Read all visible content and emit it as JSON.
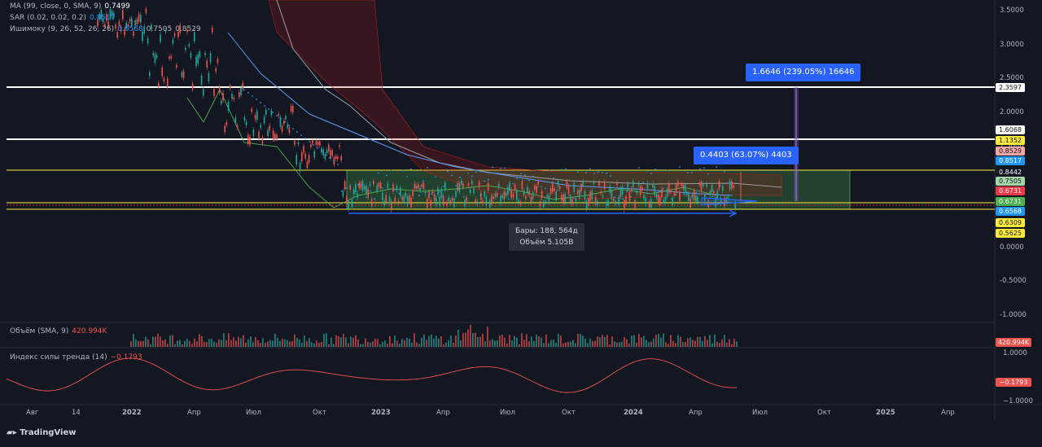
{
  "legend": {
    "ma": {
      "label": "MA (99, close, 0, SMA, 9)",
      "value": "0.7499",
      "value_color": "#ffffff"
    },
    "sar": {
      "label": "SAR (0.02, 0.02, 0.2)",
      "value": "0.8517",
      "value_color": "#2196f3"
    },
    "ichimoku": {
      "label": "Ишимоку (9, 26, 52, 26, 26)",
      "values": [
        "0.6568",
        "0.7505",
        "0.8529"
      ],
      "value_colors": [
        "#2196f3",
        "#ffffff",
        "#ffffff"
      ]
    }
  },
  "price_axis": [
    "3.5000",
    "3.0000",
    "2.5000",
    "2.0000",
    "1.5000",
    "1.0000",
    "0.5000",
    "0.0000",
    "-0.5000",
    "-1.0000"
  ],
  "price_tags": [
    {
      "text": "2.3597",
      "bg": "#ffffff",
      "fg": "#131722"
    },
    {
      "text": "1.6068",
      "bg": "#ffffff",
      "fg": "#131722"
    },
    {
      "text": "1.1352",
      "bg": "#ffeb3b",
      "fg": "#131722"
    },
    {
      "text": "0.8529",
      "bg": "#f8a5a5",
      "fg": "#131722"
    },
    {
      "text": "0.8517",
      "bg": "#2196f3",
      "fg": "#ffffff"
    },
    {
      "text": "0.8442",
      "bg": "#131722",
      "fg": "#ffffff"
    },
    {
      "text": "0.6731",
      "bg": "#f23645",
      "fg": "#ffffff"
    },
    {
      "text": "0.7505",
      "bg": "#a5d6a7",
      "fg": "#131722"
    },
    {
      "text": "0.6731",
      "bg": "#4caf50",
      "fg": "#ffffff"
    },
    {
      "text": "0.6568",
      "bg": "#2196f3",
      "fg": "#ffffff"
    },
    {
      "text": "0.6309",
      "bg": "#ffeb3b",
      "fg": "#131722"
    },
    {
      "text": "0.5625",
      "bg": "#ffeb3b",
      "fg": "#131722"
    }
  ],
  "measure_upper": "1.6646 (239.05%) 16646",
  "measure_lower": "0.4403 (63.07%) 4403",
  "range_info": {
    "bars": "Бары: 188, 564д",
    "volume": "Объём 5.105B"
  },
  "volume_pane": {
    "label": "Объём (SMA, 9)",
    "value": "420.994K",
    "tag": "420.994K"
  },
  "trend_pane": {
    "label": "Индекс силы тренда (14)",
    "value": "−0.1793",
    "tag": "−0.1793",
    "axis": [
      "1.0000",
      "−1.0000"
    ]
  },
  "time_axis": [
    "Авг",
    "14",
    "2022",
    "Апр",
    "Июл",
    "Окт",
    "2023",
    "Апр",
    "Июл",
    "Окт",
    "2024",
    "Апр",
    "Июл",
    "Окт",
    "2025",
    "Апр"
  ],
  "brand": "TradingView",
  "colors": {
    "bg": "#131722",
    "up": "#26a69a",
    "down": "#ef5350",
    "accent": "#2962ff",
    "grid": "#1e222d"
  }
}
